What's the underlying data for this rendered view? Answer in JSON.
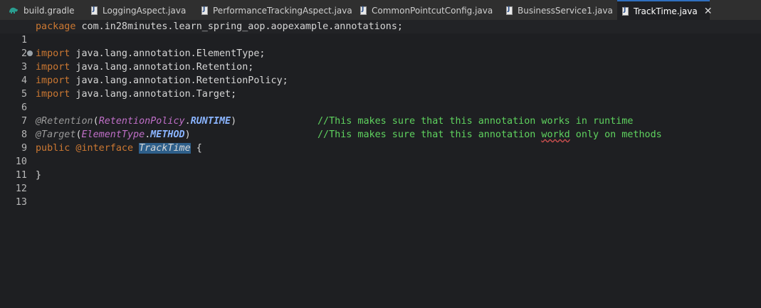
{
  "tabs": [
    {
      "label": "build.gradle",
      "icon": "gradle-icon",
      "active": false
    },
    {
      "label": "LoggingAspect.java",
      "icon": "java-file-icon",
      "active": false
    },
    {
      "label": "PerformanceTrackingAspect.java",
      "icon": "java-file-icon",
      "active": false
    },
    {
      "label": "CommonPointcutConfig.java",
      "icon": "java-file-icon",
      "active": false
    },
    {
      "label": "BusinessService1.java",
      "icon": "java-file-icon",
      "active": false
    },
    {
      "label": "TrackTime.java",
      "icon": "java-file-icon",
      "active": true,
      "close_glyph": "✕"
    }
  ],
  "editor": {
    "line_numbers": [
      "1",
      "2",
      "3",
      "4",
      "5",
      "6",
      "7",
      "8",
      "9",
      "10",
      "11",
      "12",
      "13"
    ],
    "line1": {
      "kw": "package",
      "rest": " com.in28minutes.learn_spring_aop.aopexample.annotations;"
    },
    "line3": {
      "kw": "import",
      "rest": " java.lang.annotation.ElementType;"
    },
    "line4": {
      "kw": "import",
      "rest": " java.lang.annotation.Retention;"
    },
    "line5": {
      "kw": "import",
      "rest": " java.lang.annotation.RetentionPolicy;"
    },
    "line6": {
      "kw": "import",
      "rest": " java.lang.annotation.Target;"
    },
    "line8": {
      "ann": "@Retention",
      "open": "(",
      "type": "RetentionPolicy",
      "dot": ".",
      "const": "RUNTIME",
      "close": ")",
      "comment": "//This makes sure that this annotation works in runtime"
    },
    "line9": {
      "ann": "@Target",
      "open": "(",
      "type": "ElementType",
      "dot": ".",
      "const": "METHOD",
      "close": ")",
      "comment_a": "//This makes sure that this annotation ",
      "comment_typo": "workd",
      "comment_b": " only on methods"
    },
    "line10": {
      "kw": "public",
      "ann": " @interface ",
      "name": "TrackTime",
      "rest": " {"
    },
    "line12": {
      "text": "}"
    }
  },
  "colors": {
    "keyword": "#cc7832",
    "comment": "#5fd35f",
    "type": "#c06fc8",
    "constant": "#8ab4ff",
    "selection": "#2e5f8a",
    "background": "#1e1f22"
  }
}
